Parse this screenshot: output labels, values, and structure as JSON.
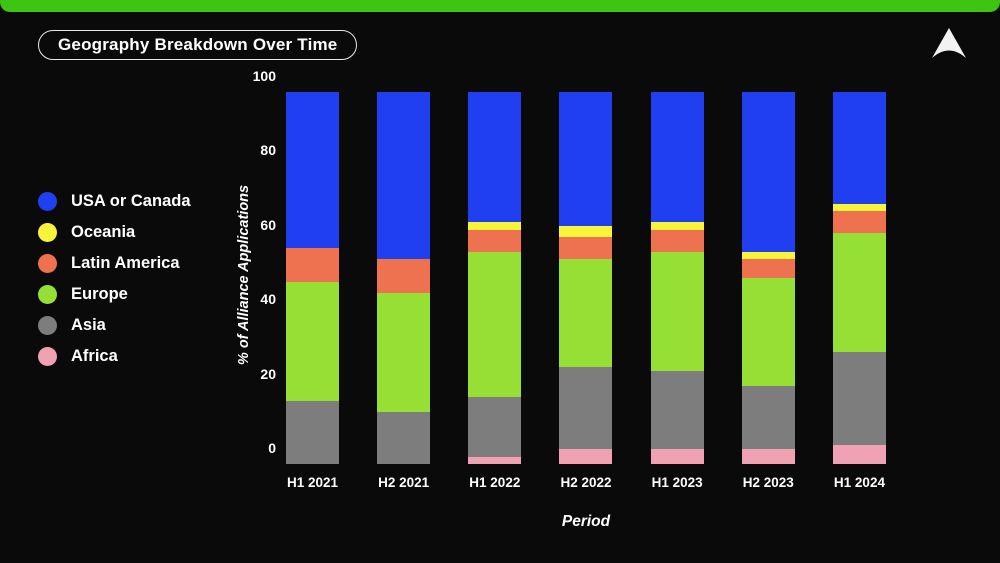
{
  "slide": {
    "title": "Geography Breakdown Over Time",
    "logo_icon": "triangle-arrow-logo",
    "accent_color": "#3ec514",
    "background_color": "#0a0a0a"
  },
  "legend": {
    "items": [
      {
        "label": "USA or Canada",
        "color": "#1f3ff0"
      },
      {
        "label": "Oceania",
        "color": "#f7f43a"
      },
      {
        "label": "Latin America",
        "color": "#ef7250"
      },
      {
        "label": "Europe",
        "color": "#96e035"
      },
      {
        "label": "Asia",
        "color": "#7d7d7d"
      },
      {
        "label": "Africa",
        "color": "#f0a1b2"
      }
    ]
  },
  "chart_data": {
    "type": "bar",
    "stacked": true,
    "title": "Geography Breakdown Over Time",
    "xlabel": "Period",
    "ylabel": "% of Alliance Applications",
    "ylim": [
      0,
      100
    ],
    "yticks": [
      0,
      20,
      40,
      60,
      80,
      100
    ],
    "grid": false,
    "legend_position": "left",
    "categories": [
      "H1 2021",
      "H2 2021",
      "H1 2022",
      "H2 2022",
      "H1 2023",
      "H2 2023",
      "H1 2024"
    ],
    "series": [
      {
        "name": "Africa",
        "color": "#f0a1b2",
        "values": [
          0,
          0,
          2,
          4,
          4,
          4,
          5
        ]
      },
      {
        "name": "Asia",
        "color": "#7d7d7d",
        "values": [
          17,
          14,
          16,
          22,
          21,
          17,
          25
        ]
      },
      {
        "name": "Europe",
        "color": "#96e035",
        "values": [
          32,
          32,
          39,
          29,
          32,
          29,
          32
        ]
      },
      {
        "name": "Latin America",
        "color": "#ef7250",
        "values": [
          9,
          9,
          6,
          6,
          6,
          5,
          6
        ]
      },
      {
        "name": "Oceania",
        "color": "#f7f43a",
        "values": [
          0,
          0,
          2,
          3,
          2,
          2,
          2
        ]
      },
      {
        "name": "USA or Canada",
        "color": "#1f3ff0",
        "values": [
          42,
          45,
          35,
          36,
          35,
          43,
          30
        ]
      }
    ]
  }
}
